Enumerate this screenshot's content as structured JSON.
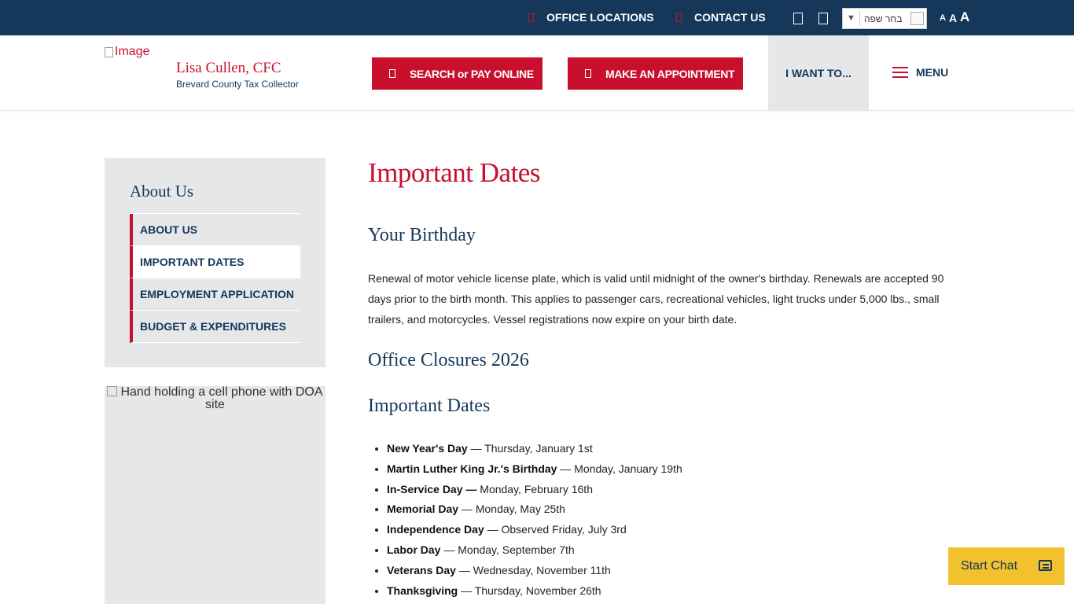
{
  "topbar": {
    "office_locations": "OFFICE LOCATIONS",
    "contact_us": "CONTACT US",
    "language_select": "בחר שפה",
    "language_arrow": "▼",
    "font_small": "A",
    "font_medium": "A",
    "font_large": "A"
  },
  "header": {
    "logo_alt": "Image",
    "logo_name": "Lisa Cullen, CFC",
    "logo_subtitle": "Brevard County Tax Collector",
    "search_pay_button": "SEARCH or PAY ONLINE",
    "appointment_button": "MAKE AN APPOINTMENT",
    "i_want_to": "I WANT TO...",
    "menu": "MENU"
  },
  "sidebar": {
    "title": "About Us",
    "items": [
      {
        "label": "ABOUT US",
        "active": false
      },
      {
        "label": "IMPORTANT DATES",
        "active": true
      },
      {
        "label": "EMPLOYMENT APPLICATION",
        "active": false
      },
      {
        "label": "BUDGET & EXPENDITURES",
        "active": false
      }
    ],
    "promo_image_alt": "Hand holding a cell phone with DOA site"
  },
  "main": {
    "page_title": "Important Dates",
    "birthday_heading": "Your Birthday",
    "birthday_text": "Renewal of motor vehicle license plate, which is valid until midnight of the owner's birthday. Renewals are accepted 90 days prior to the birth month. This applies to passenger cars, recreational vehicles, light trucks under 5,000 lbs., small trailers, and motorcycles. Vessel registrations now expire on your birth date.",
    "closures_heading": "Office Closures 2026",
    "dates_heading": "Important Dates",
    "dates": [
      {
        "name": "New Year's Day",
        "sep": " — ",
        "date": "Thursday, January 1st"
      },
      {
        "name": "Martin Luther King Jr.'s Birthday",
        "sep": " — ",
        "date": "Monday, January 19th"
      },
      {
        "name": "In-Service Day —",
        "sep": " ",
        "date": "Monday, February 16th"
      },
      {
        "name": "Memorial Day",
        "sep": " — ",
        "date": "Monday, May 25th"
      },
      {
        "name": "Independence Day",
        "sep": " — ",
        "date": "Observed Friday, July 3rd"
      },
      {
        "name": "Labor Day",
        "sep": " — ",
        "date": "Monday, September 7th"
      },
      {
        "name": "Veterans Day",
        "sep": " — ",
        "date": "Wednesday, November 11th"
      },
      {
        "name": "Thanksgiving",
        "sep": " — ",
        "date": "Thursday, November 26th"
      }
    ]
  },
  "chat": {
    "label": "Start Chat"
  },
  "colors": {
    "navy": "#14375a",
    "red": "#c8102e",
    "gray": "#e5e7e9",
    "chat_yellow": "#f2c12e"
  },
  "icons": [
    "map-marker-icon",
    "phone-icon",
    "facebook-icon",
    "twitter-icon",
    "search-icon",
    "calendar-icon",
    "hamburger-icon",
    "chat-icon"
  ]
}
